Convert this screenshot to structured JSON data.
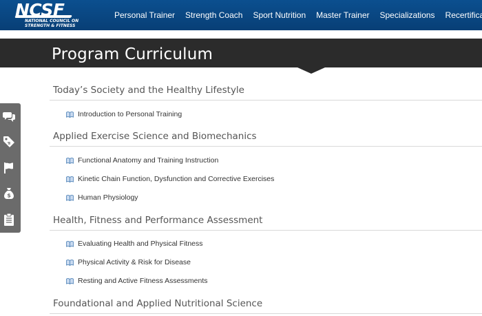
{
  "header": {
    "logo_text": "NCSF",
    "logo_sub_line1": "NATIONAL COUNCIL ON",
    "logo_sub_line2": "STRENGTH & FITNESS",
    "nav": [
      {
        "label": "Personal Trainer"
      },
      {
        "label": "Strength Coach"
      },
      {
        "label": "Sport Nutrition"
      },
      {
        "label": "Master Trainer"
      },
      {
        "label": "Specializations"
      },
      {
        "label": "Recertification"
      }
    ]
  },
  "page": {
    "title": "Program Curriculum"
  },
  "side_toolbar": {
    "icons": [
      "chat-bubbles-icon",
      "price-tag-icon",
      "flag-icon",
      "money-bag-icon",
      "clipboard-icon"
    ]
  },
  "curriculum": [
    {
      "heading": "Today’s Society and the Healthy Lifestyle",
      "lessons": [
        "Introduction to Personal Training"
      ]
    },
    {
      "heading": "Applied Exercise Science and Biomechanics",
      "lessons": [
        "Functional Anatomy and Training Instruction",
        "Kinetic Chain Function, Dysfunction and Corrective Exercises",
        "Human Physiology"
      ]
    },
    {
      "heading": "Health, Fitness and Performance Assessment",
      "lessons": [
        "Evaluating Health and Physical Fitness",
        "Physical Activity & Risk for Disease",
        "Resting and Active Fitness Assessments"
      ]
    },
    {
      "heading": "Foundational and Applied Nutritional Science",
      "lessons": []
    }
  ],
  "colors": {
    "nav_bg": "#0b4f8f",
    "title_band": "#2b2b2b",
    "side_toolbar": "#6b6b6b",
    "heading_text": "#555555",
    "book_icon": "#4a7fb5"
  }
}
